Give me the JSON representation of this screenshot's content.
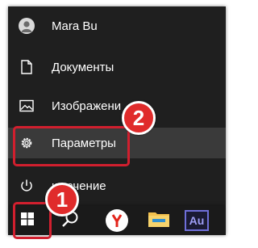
{
  "start_menu": {
    "user_name": "Mara Bu",
    "items": [
      {
        "label": "Документы",
        "icon": "document-icon"
      },
      {
        "label": "Изображени",
        "icon": "image-icon"
      },
      {
        "label": "Параметры",
        "icon": "gear-icon"
      },
      {
        "label": "ключение",
        "icon": "power-icon"
      }
    ]
  },
  "taskbar": {
    "buttons": [
      {
        "name": "start",
        "icon": "windows-logo-icon"
      },
      {
        "name": "search",
        "icon": "search-icon"
      },
      {
        "name": "yandex-browser",
        "icon": "yandex-icon"
      },
      {
        "name": "file-explorer",
        "icon": "folder-icon"
      },
      {
        "name": "adobe-audition",
        "icon": "audition-icon",
        "text": "Au"
      }
    ]
  },
  "annotations": {
    "badge_1": "1",
    "badge_2": "2",
    "highlight_color": "#d11f2e",
    "badge_color": "#e02b2b"
  },
  "colors": {
    "menu_bg": "#1f1f1f",
    "selected_bg": "#3a3a3a",
    "taskbar_bg": "#1a1a1a"
  }
}
